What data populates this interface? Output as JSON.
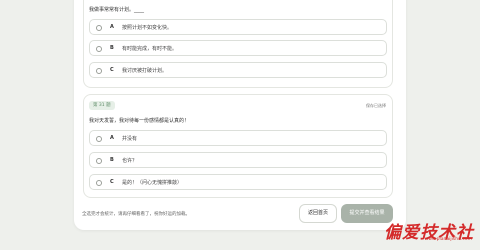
{
  "question1": {
    "text": "我做事常常有计划。____",
    "options": [
      {
        "letter": "A",
        "text": "按照计划不如变化快。"
      },
      {
        "letter": "B",
        "text": "有时能完成，有时不能。"
      },
      {
        "letter": "C",
        "text": "我讨厌被打破计划。"
      }
    ]
  },
  "question2": {
    "badge": "第 31 题",
    "status": "保存已选择",
    "text": "我对天发誓，我对待每一份感情都是认真的！",
    "options": [
      {
        "letter": "A",
        "text": "并没有"
      },
      {
        "letter": "B",
        "text": "也许？"
      },
      {
        "letter": "C",
        "text": "是的！（问心无愧拼推敲）"
      }
    ]
  },
  "footer": {
    "note": "全选完才会统计，请再仔细看看了，祝你好运的加载。",
    "back_label": "返回首页",
    "submit_label": "提交并查看结果"
  },
  "watermark": {
    "text": "偏爱技术社",
    "url": "www.pianaijishu.com"
  },
  "colors": {
    "accent": "#5f8d69",
    "submit_bg": "#a9b3a9",
    "watermark": "#d42a2a"
  }
}
